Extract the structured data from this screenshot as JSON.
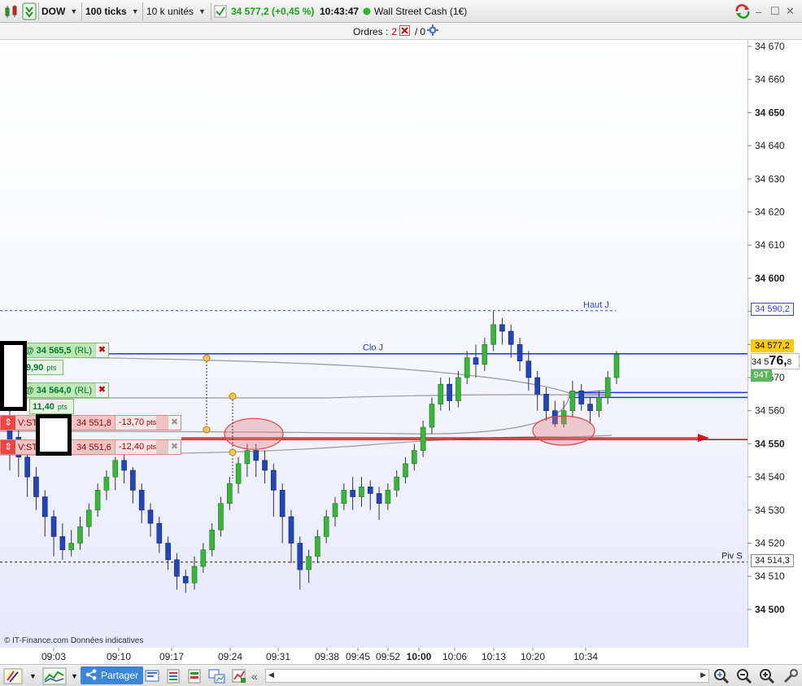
{
  "toolbar": {
    "symbol": "DOW",
    "interval": "100 ticks",
    "units": "10 k unités",
    "price_change": "34 577,2 (+0,45 %)",
    "time": "10:43:47",
    "instrument": "Wall Street Cash (1€)"
  },
  "orders": {
    "label": "Ordres :",
    "count_pending": "2",
    "separator": "/",
    "count_filled": "0"
  },
  "chart": {
    "watermark": "© IT-Finance.com  Données indicatives",
    "y_ticks": [
      "34 670",
      "34 660",
      "34 650",
      "34 640",
      "34 630",
      "34 620",
      "34 610",
      "34 600",
      "34 590",
      "34 580",
      "34 570",
      "34 560",
      "34 550",
      "34 540",
      "34 530",
      "34 520",
      "34 510",
      "34 500"
    ],
    "y_tick_values": [
      34670,
      34660,
      34650,
      34640,
      34630,
      34620,
      34610,
      34600,
      34590,
      34580,
      34570,
      34560,
      34550,
      34540,
      34530,
      34520,
      34510,
      34500
    ],
    "x_ticks": [
      "09:03",
      "09:10",
      "09:17",
      "09:24",
      "09:31",
      "09:38",
      "09:45",
      "09:52",
      "10:00",
      "10:06",
      "10:13",
      "10:20",
      "10:34"
    ],
    "levels": {
      "haut_j": {
        "label": "Haut J",
        "value": 34590.2,
        "tag": "34 590,2",
        "color": "#2a4ccc"
      },
      "clo_j": {
        "label": "Clo J",
        "value": 34577.2,
        "color": "#1a3bd6"
      },
      "piv_s": {
        "label": "Piv S",
        "value": 34514.3,
        "tag": "34 514,3",
        "color": "#222222"
      }
    },
    "last_price": {
      "tag": "34 577,2",
      "color": "#ffcc00"
    },
    "cursor_price": {
      "prefix": "34 5",
      "big": "76,",
      "small": "8"
    },
    "tick_counter": "94T",
    "order_tags": [
      {
        "kind": "buy",
        "price": "@ 34 565,5",
        "suffix": "(RL)",
        "pts": "9,90",
        "pts_unit": "pts"
      },
      {
        "kind": "buy",
        "price": "@ 34 564,0",
        "suffix": "(RL)",
        "pts": "11,40",
        "pts_unit": "pts"
      },
      {
        "kind": "stop",
        "label": "V:ST",
        "price": "34 551,8",
        "pts": "-13,70",
        "pts_unit": "pts"
      },
      {
        "kind": "stop",
        "label": "V:ST",
        "price": "34 551,6",
        "pts": "-12,40",
        "pts_unit": "pts"
      }
    ],
    "colors": {
      "up": "#3cb43c",
      "down": "#2345b8",
      "red_line": "#e01010"
    }
  },
  "bottombar": {
    "share": "Partager"
  }
}
